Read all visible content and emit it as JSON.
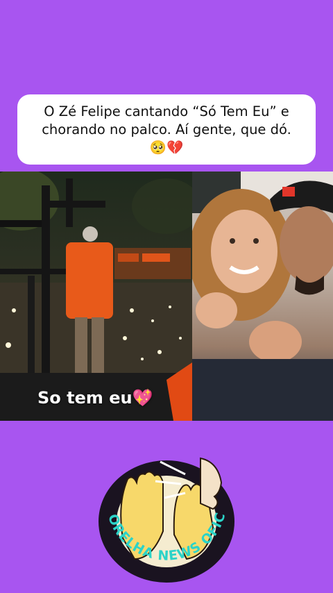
{
  "post": {
    "caption_line1": "O Zé Felipe cantando “Só Tem Eu” e",
    "caption_line2": "chorando no palco. Aí gente, que dó.",
    "caption_emoji": "🥺💔"
  },
  "concert_video": {
    "overlay_text": "So tem eu💖"
  },
  "logo": {
    "text": "NA ORELHA NEWS OFICIAL"
  },
  "colors": {
    "background": "#a855f0",
    "card": "#ffffff",
    "logo_ring": "#1a1320"
  }
}
